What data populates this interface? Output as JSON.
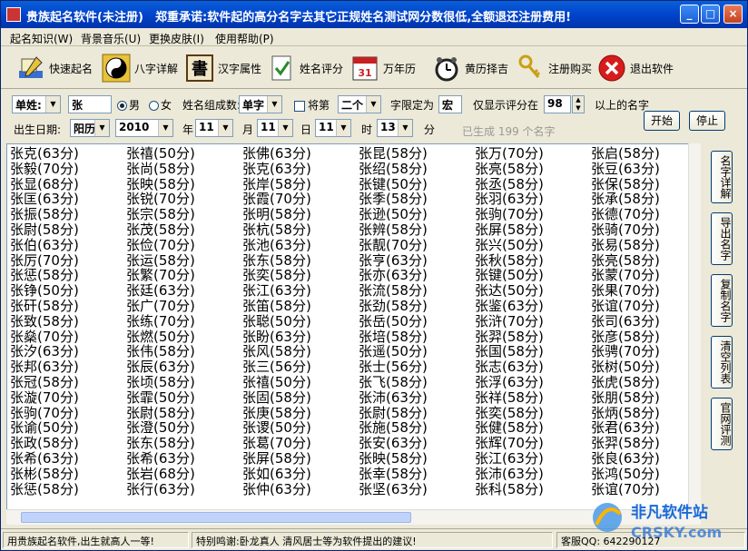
{
  "title": {
    "app": "贵族起名软件(未注册)",
    "notice": "郑重承诺:软件起的高分名字去其它正规姓名测试网分数很低,全额退还注册费用!"
  },
  "window_buttons": [
    "_",
    "□",
    "×"
  ],
  "menu": [
    "起名知识(W)",
    "背景音乐(U)",
    "更换皮肤(I)",
    "使用帮助(P)"
  ],
  "toolbar": [
    {
      "label": "快速起名",
      "icon": "pen-icon"
    },
    {
      "label": "八字详解",
      "icon": "yin-yang-icon"
    },
    {
      "label": "汉字属性",
      "icon": "calligraphy-icon"
    },
    {
      "label": "姓名评分",
      "icon": "check-icon"
    },
    {
      "label": "万年历",
      "icon": "calendar-icon"
    },
    {
      "label": "黄历择吉",
      "icon": "alarm-clock-icon"
    },
    {
      "label": "注册购买",
      "icon": "key-icon"
    },
    {
      "label": "退出软件",
      "icon": "exit-icon"
    }
  ],
  "options": {
    "surname_type": "单姓:",
    "surname": "张",
    "gender_male": "男",
    "gender_female": "女",
    "name_count_label": "姓名组成数:",
    "name_count": "单字",
    "position_label": "将第",
    "position_value": "二个",
    "limit_label": "字限定为",
    "limit_value": "宏",
    "score_label": "仅显示评分在",
    "score_value": "98",
    "score_suffix": "以上的名字",
    "birth_label": "出生日期:",
    "calendar": "阳历",
    "year": "2010",
    "year_label": "年",
    "month": "11",
    "month_label": "月",
    "day": "11",
    "day_label": "日",
    "hour_day": "11",
    "hour_label": "时",
    "minute": "13",
    "minute_label": "分",
    "generated": "已生成  199  个名字",
    "start": "开始",
    "stop": "停止"
  },
  "names": [
    [
      "张克(63分)",
      "张毅(70分)",
      "张显(68分)",
      "张匡(63分)",
      "张振(58分)",
      "张尉(58分)",
      "张伯(63分)",
      "张厉(70分)",
      "张惩(58分)",
      "张铮(50分)",
      "张矸(58分)",
      "张致(58分)",
      "张燊(70分)",
      "张汐(63分)",
      "张邦(63分)",
      "张冠(58分)",
      "张漩(70分)",
      "张驹(70分)",
      "张谕(50分)",
      "张政(58分)",
      "张希(63分)",
      "张彬(58分)",
      "张惩(58分)"
    ],
    [
      "张禧(50分)",
      "张尚(58分)",
      "张映(58分)",
      "张锐(70分)",
      "张宗(58分)",
      "张茂(58分)",
      "张俭(70分)",
      "张运(58分)",
      "张繁(70分)",
      "张廷(63分)",
      "张广(70分)",
      "张练(70分)",
      "张燃(50分)",
      "张伟(58分)",
      "张辰(63分)",
      "张顷(58分)",
      "张霏(50分)",
      "张尉(58分)",
      "张澄(50分)",
      "张东(58分)",
      "张希(63分)",
      "张岩(68分)",
      "张行(63分)"
    ],
    [
      "张佛(63分)",
      "张克(63分)",
      "张岸(58分)",
      "张霞(70分)",
      "张明(58分)",
      "张杭(58分)",
      "张池(63分)",
      "张东(58分)",
      "张奕(58分)",
      "张江(63分)",
      "张笛(58分)",
      "张聪(50分)",
      "张盼(63分)",
      "张风(58分)",
      "张三(56分)",
      "张禧(50分)",
      "张固(58分)",
      "张庚(58分)",
      "张谡(50分)",
      "张葛(70分)",
      "张屏(58分)",
      "张如(63分)",
      "张仲(63分)"
    ],
    [
      "张昆(58分)",
      "张绍(58分)",
      "张键(50分)",
      "张季(58分)",
      "张逊(50分)",
      "张辨(58分)",
      "张靓(70分)",
      "张亨(63分)",
      "张亦(63分)",
      "张流(58分)",
      "张劲(58分)",
      "张岳(50分)",
      "张培(58分)",
      "张遥(50分)",
      "张士(56分)",
      "张飞(58分)",
      "张沛(63分)",
      "张尉(58分)",
      "张施(58分)",
      "张安(63分)",
      "张映(58分)",
      "张幸(58分)",
      "张坚(63分)"
    ],
    [
      "张万(70分)",
      "张亮(58分)",
      "张丞(58分)",
      "张羽(63分)",
      "张驹(70分)",
      "张屏(58分)",
      "张兴(50分)",
      "张秋(58分)",
      "张键(50分)",
      "张达(50分)",
      "张鉴(63分)",
      "张浒(70分)",
      "张羿(58分)",
      "张国(58分)",
      "张志(63分)",
      "张浮(63分)",
      "张祥(58分)",
      "张奕(58分)",
      "张健(58分)",
      "张辉(70分)",
      "张江(63分)",
      "张沛(63分)",
      "张科(58分)"
    ],
    [
      "张启(58分)",
      "张豆(63分)",
      "张保(58分)",
      "张承(58分)",
      "张德(70分)",
      "张骑(70分)",
      "张易(58分)",
      "张亮(58分)",
      "张蒙(70分)",
      "张果(70分)",
      "张谊(70分)",
      "张司(63分)",
      "张彦(58分)",
      "张骋(70分)",
      "张树(50分)",
      "张虎(58分)",
      "张朋(58分)",
      "张炳(58分)",
      "张君(63分)",
      "张羿(58分)",
      "张良(63分)",
      "张鸿(50分)",
      "张谊(70分)"
    ]
  ],
  "side_buttons": [
    "名字详解",
    "导出名字",
    "复制名字",
    "清空列表",
    "官网评测"
  ],
  "status": {
    "s1": "用贵族起名软件,出生就高人一等!",
    "s2": "特别鸣谢:卧龙真人  清风居士等为软件提出的建议!",
    "s3": "客服QQ: 642290127"
  },
  "watermark": {
    "line1": "非凡软件站",
    "line2": "CRSKY.com"
  },
  "colors": {
    "titlebar": "#0044cc",
    "watermark": "#1a6ad8"
  }
}
